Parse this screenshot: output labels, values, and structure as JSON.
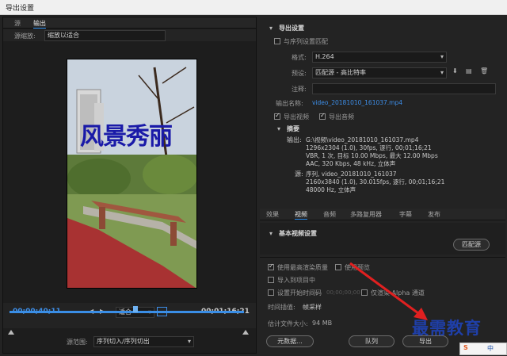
{
  "window": {
    "title": "导出设置"
  },
  "left": {
    "tabs": [
      "源",
      "输出"
    ],
    "source_scale_label": "源缩放:",
    "source_scale_value": "缩放以适合",
    "preview_overlay_text": "风景秀丽",
    "timecode_current": "00;00;40;11",
    "fit_value": "适合",
    "timecode_duration": "00;01;16;21",
    "source_range_label": "源范围:",
    "source_range_value": "序列切入/序列切出"
  },
  "export_settings": {
    "header": "导出设置",
    "match_sequence_label": "与序列设置匹配",
    "format_label": "格式:",
    "format_value": "H.264",
    "preset_label": "预设:",
    "preset_value": "匹配源 - 高比特率",
    "comment_label": "注释:",
    "output_name_label": "输出名称:",
    "output_name_value": "video_20181010_161037.mp4",
    "export_video_label": "导出视频",
    "export_audio_label": "导出音频"
  },
  "summary": {
    "header": "摘要",
    "output_label": "输出:",
    "output_lines": [
      "G:\\视频\\video_20181010_161037.mp4",
      "1296x2304 (1.0), 30fps, 逐行, 00;01;16;21",
      "VBR, 1 次, 目标 10.00 Mbps, 最大 12.00 Mbps",
      "AAC, 320 Kbps, 48 kHz, 立体声"
    ],
    "source_label": "源:",
    "source_lines": [
      "序列, video_20181010_161037",
      "2160x3840 (1.0), 30.015fps, 逐行, 00;01;16;21",
      "48000 Hz, 立体声"
    ]
  },
  "settings_tabs": [
    "效果",
    "视频",
    "音频",
    "多路复用器",
    "字幕",
    "发布"
  ],
  "basic_video": {
    "header": "基本视频设置",
    "match_source_button": "匹配源"
  },
  "bottom": {
    "max_render_quality": "使用最高渲染质量",
    "use_preview": "使用预览",
    "import_to_project": "导入到项目中",
    "set_start_timecode": "设置开始时间码",
    "start_timecode_value": "00;00;00;00",
    "render_alpha_only": "仅渲染 Alpha 通道",
    "time_interpolation_label": "时间插值:",
    "time_interpolation_value": "帧采样",
    "estimated_size_label": "估计文件大小:",
    "estimated_size_value": "94 MB",
    "metadata_button": "元数据...",
    "queue_button": "队列",
    "export_button": "导出"
  },
  "watermark_text": "最需教育",
  "ime": {
    "logo": "S",
    "lang": "中"
  }
}
